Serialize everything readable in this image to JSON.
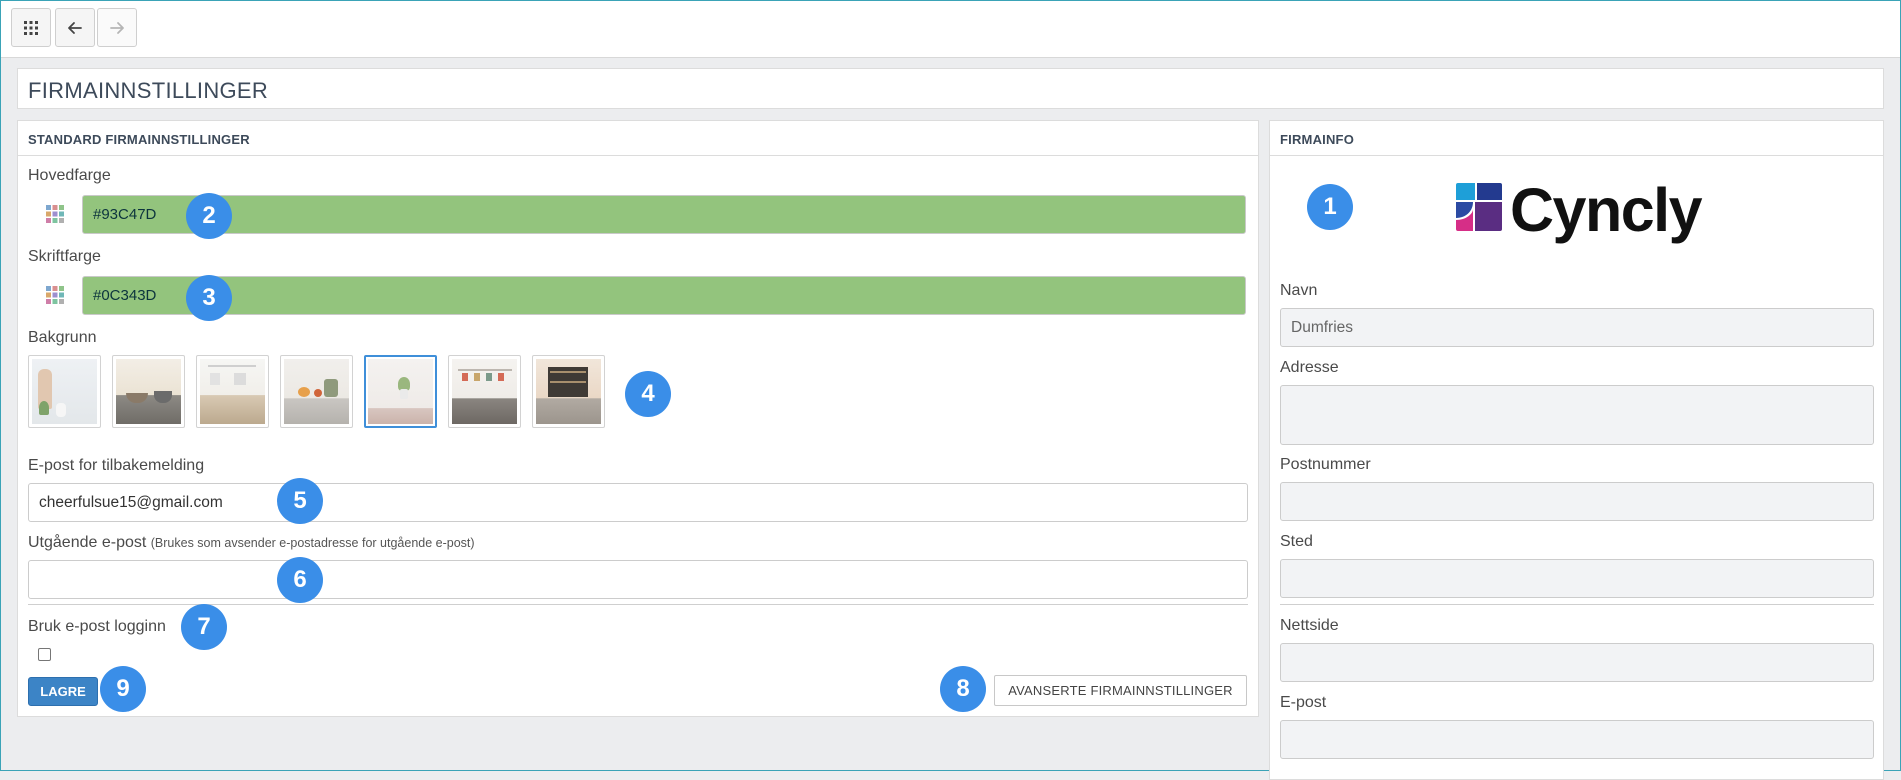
{
  "toolbar": {
    "apps_icon": "grid-icon",
    "back_icon": "arrow-left-icon",
    "forward_icon": "arrow-right-icon"
  },
  "page": {
    "title": "FIRMAINNSTILLINGER"
  },
  "standard_panel": {
    "header": "STANDARD FIRMAINNSTILLINGER",
    "primary_color": {
      "label": "Hovedfarge",
      "value": "#93C47D"
    },
    "text_color": {
      "label": "Skriftfarge",
      "value": "#0C343D"
    },
    "background": {
      "label": "Bakgrunn",
      "selected_index": 4,
      "thumbnail_count": 7
    },
    "feedback_email": {
      "label": "E-post for tilbakemelding",
      "value": "cheerfulsue15@gmail.com"
    },
    "outgoing_email": {
      "label": "Utgående e-post",
      "hint": "(Brukes som avsender e-postadresse for utgående e-post)",
      "value": ""
    },
    "use_email_login": {
      "label": "Bruk e-post logginn",
      "checked": false
    },
    "save_label": "LAGRE",
    "advanced_label": "AVANSERTE FIRMAINNSTILLINGER"
  },
  "info_panel": {
    "header": "FIRMAINFO",
    "logo_text": "Cyncly",
    "name": {
      "label": "Navn",
      "value": "Dumfries"
    },
    "address": {
      "label": "Adresse",
      "value": ""
    },
    "postal_code": {
      "label": "Postnummer",
      "value": ""
    },
    "city": {
      "label": "Sted",
      "value": ""
    },
    "website": {
      "label": "Nettside",
      "value": ""
    },
    "email": {
      "label": "E-post",
      "value": ""
    }
  },
  "markers": [
    "1",
    "2",
    "3",
    "4",
    "5",
    "6",
    "7",
    "8",
    "9"
  ],
  "colors": {
    "accent": "#3a8ee8",
    "primary_button": "#3c84c6",
    "swatch_fill": "#93c47d",
    "swatch_text": "#0c343d"
  }
}
